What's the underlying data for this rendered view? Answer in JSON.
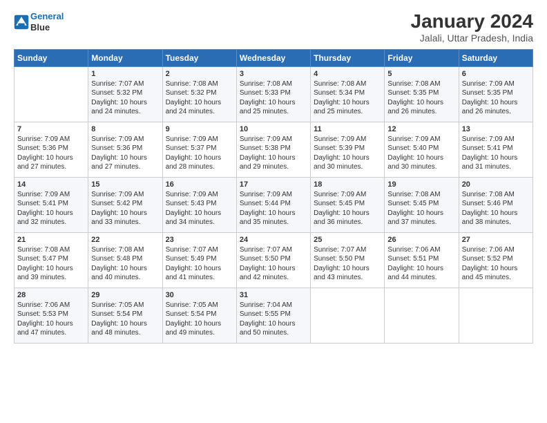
{
  "logo": {
    "line1": "General",
    "line2": "Blue"
  },
  "title": "January 2024",
  "subtitle": "Jalali, Uttar Pradesh, India",
  "weekdays": [
    "Sunday",
    "Monday",
    "Tuesday",
    "Wednesday",
    "Thursday",
    "Friday",
    "Saturday"
  ],
  "weeks": [
    [
      {
        "day": "",
        "info": ""
      },
      {
        "day": "1",
        "info": "Sunrise: 7:07 AM\nSunset: 5:32 PM\nDaylight: 10 hours\nand 24 minutes."
      },
      {
        "day": "2",
        "info": "Sunrise: 7:08 AM\nSunset: 5:32 PM\nDaylight: 10 hours\nand 24 minutes."
      },
      {
        "day": "3",
        "info": "Sunrise: 7:08 AM\nSunset: 5:33 PM\nDaylight: 10 hours\nand 25 minutes."
      },
      {
        "day": "4",
        "info": "Sunrise: 7:08 AM\nSunset: 5:34 PM\nDaylight: 10 hours\nand 25 minutes."
      },
      {
        "day": "5",
        "info": "Sunrise: 7:08 AM\nSunset: 5:35 PM\nDaylight: 10 hours\nand 26 minutes."
      },
      {
        "day": "6",
        "info": "Sunrise: 7:09 AM\nSunset: 5:35 PM\nDaylight: 10 hours\nand 26 minutes."
      }
    ],
    [
      {
        "day": "7",
        "info": "Sunrise: 7:09 AM\nSunset: 5:36 PM\nDaylight: 10 hours\nand 27 minutes."
      },
      {
        "day": "8",
        "info": "Sunrise: 7:09 AM\nSunset: 5:36 PM\nDaylight: 10 hours\nand 27 minutes."
      },
      {
        "day": "9",
        "info": "Sunrise: 7:09 AM\nSunset: 5:37 PM\nDaylight: 10 hours\nand 28 minutes."
      },
      {
        "day": "10",
        "info": "Sunrise: 7:09 AM\nSunset: 5:38 PM\nDaylight: 10 hours\nand 29 minutes."
      },
      {
        "day": "11",
        "info": "Sunrise: 7:09 AM\nSunset: 5:39 PM\nDaylight: 10 hours\nand 30 minutes."
      },
      {
        "day": "12",
        "info": "Sunrise: 7:09 AM\nSunset: 5:40 PM\nDaylight: 10 hours\nand 30 minutes."
      },
      {
        "day": "13",
        "info": "Sunrise: 7:09 AM\nSunset: 5:41 PM\nDaylight: 10 hours\nand 31 minutes."
      }
    ],
    [
      {
        "day": "14",
        "info": "Sunrise: 7:09 AM\nSunset: 5:41 PM\nDaylight: 10 hours\nand 32 minutes."
      },
      {
        "day": "15",
        "info": "Sunrise: 7:09 AM\nSunset: 5:42 PM\nDaylight: 10 hours\nand 33 minutes."
      },
      {
        "day": "16",
        "info": "Sunrise: 7:09 AM\nSunset: 5:43 PM\nDaylight: 10 hours\nand 34 minutes."
      },
      {
        "day": "17",
        "info": "Sunrise: 7:09 AM\nSunset: 5:44 PM\nDaylight: 10 hours\nand 35 minutes."
      },
      {
        "day": "18",
        "info": "Sunrise: 7:09 AM\nSunset: 5:45 PM\nDaylight: 10 hours\nand 36 minutes."
      },
      {
        "day": "19",
        "info": "Sunrise: 7:08 AM\nSunset: 5:45 PM\nDaylight: 10 hours\nand 37 minutes."
      },
      {
        "day": "20",
        "info": "Sunrise: 7:08 AM\nSunset: 5:46 PM\nDaylight: 10 hours\nand 38 minutes."
      }
    ],
    [
      {
        "day": "21",
        "info": "Sunrise: 7:08 AM\nSunset: 5:47 PM\nDaylight: 10 hours\nand 39 minutes."
      },
      {
        "day": "22",
        "info": "Sunrise: 7:08 AM\nSunset: 5:48 PM\nDaylight: 10 hours\nand 40 minutes."
      },
      {
        "day": "23",
        "info": "Sunrise: 7:07 AM\nSunset: 5:49 PM\nDaylight: 10 hours\nand 41 minutes."
      },
      {
        "day": "24",
        "info": "Sunrise: 7:07 AM\nSunset: 5:50 PM\nDaylight: 10 hours\nand 42 minutes."
      },
      {
        "day": "25",
        "info": "Sunrise: 7:07 AM\nSunset: 5:50 PM\nDaylight: 10 hours\nand 43 minutes."
      },
      {
        "day": "26",
        "info": "Sunrise: 7:06 AM\nSunset: 5:51 PM\nDaylight: 10 hours\nand 44 minutes."
      },
      {
        "day": "27",
        "info": "Sunrise: 7:06 AM\nSunset: 5:52 PM\nDaylight: 10 hours\nand 45 minutes."
      }
    ],
    [
      {
        "day": "28",
        "info": "Sunrise: 7:06 AM\nSunset: 5:53 PM\nDaylight: 10 hours\nand 47 minutes."
      },
      {
        "day": "29",
        "info": "Sunrise: 7:05 AM\nSunset: 5:54 PM\nDaylight: 10 hours\nand 48 minutes."
      },
      {
        "day": "30",
        "info": "Sunrise: 7:05 AM\nSunset: 5:54 PM\nDaylight: 10 hours\nand 49 minutes."
      },
      {
        "day": "31",
        "info": "Sunrise: 7:04 AM\nSunset: 5:55 PM\nDaylight: 10 hours\nand 50 minutes."
      },
      {
        "day": "",
        "info": ""
      },
      {
        "day": "",
        "info": ""
      },
      {
        "day": "",
        "info": ""
      }
    ]
  ]
}
